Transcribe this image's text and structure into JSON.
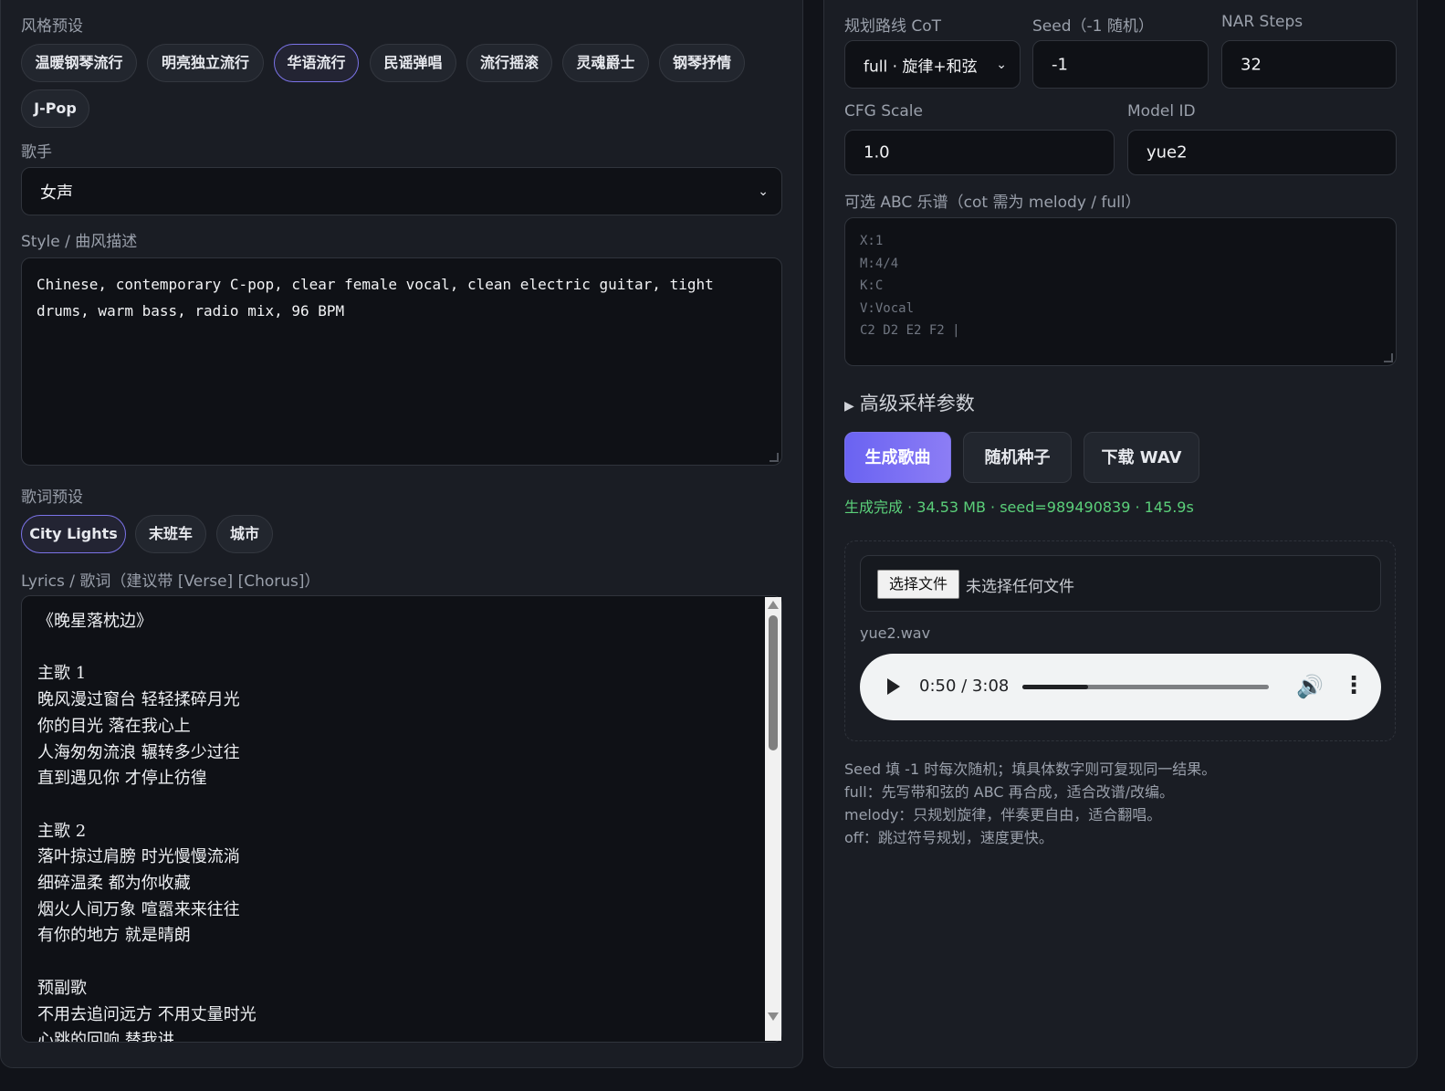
{
  "left": {
    "style_presets_label": "风格预设",
    "style_presets": [
      {
        "label": "温暖钢琴流行",
        "active": false
      },
      {
        "label": "明亮独立流行",
        "active": false
      },
      {
        "label": "华语流行",
        "active": true
      },
      {
        "label": "民谣弹唱",
        "active": false
      },
      {
        "label": "流行摇滚",
        "active": false
      },
      {
        "label": "灵魂爵士",
        "active": false
      },
      {
        "label": "钢琴抒情",
        "active": false
      },
      {
        "label": "J-Pop",
        "active": false
      }
    ],
    "singer_label": "歌手",
    "singer_value": "女声",
    "style_label": "Style / 曲风描述",
    "style_text": "Chinese, contemporary C-pop, clear female vocal, clean electric guitar, tight\ndrums, warm bass, radio mix, 96 BPM",
    "lyrics_presets_label": "歌词预设",
    "lyrics_presets": [
      {
        "label": "City Lights",
        "active": true
      },
      {
        "label": "末班车",
        "active": false
      },
      {
        "label": "城市",
        "active": false
      }
    ],
    "lyrics_label": "Lyrics / 歌词（建议带 [Verse] [Chorus]）",
    "lyrics_text": "《晚星落枕边》\n\n主歌 1\n晚风漫过窗台 轻轻揉碎月光\n你的目光 落在我心上\n人海匆匆流浪 辗转多少过往\n直到遇见你 才停止彷徨\n\n主歌 2\n落叶掠过肩膀 时光慢慢流淌\n细碎温柔 都为你收藏\n烟火人间万象 喧嚣来来往往\n有你的地方 就是晴朗\n\n预副歌\n不用去追问远方 不用丈量时光\n心跳的回响 替我讲"
  },
  "right": {
    "cot_label": "规划路线 CoT",
    "cot_value": "full · 旋律+和弦",
    "seed_label": "Seed（-1 随机）",
    "seed_value": "-1",
    "nar_label": "NAR Steps",
    "nar_value": "32",
    "cfg_label": "CFG Scale",
    "cfg_value": "1.0",
    "model_label": "Model ID",
    "model_value": "yue2",
    "abc_label": "可选 ABC 乐谱（cot 需为 melody / full）",
    "abc_placeholder": "X:1\nM:4/4\nK:C\nV:Vocal\nC2 D2 E2 F2 |",
    "advanced_label": "高级采样参数",
    "btn_generate": "生成歌曲",
    "btn_random_seed": "随机种子",
    "btn_download": "下载 WAV",
    "status_prefix": "生成完成",
    "status_detail": " · 34.53 MB · seed=989490839 · 145.9s",
    "file_button": "选择文件",
    "file_note": "未选择任何文件",
    "audio_filename": "yue2.wav",
    "audio_time": "0:50 / 3:08",
    "audio_progress": 0.2659,
    "help_lines": [
      "Seed 填 -1 时每次随机；填具体数字则可复现同一结果。",
      "full：先写带和弦的 ABC 再合成，适合改谱/改编。",
      "melody：只规划旋律，伴奏更自由，适合翻唱。",
      "off：跳过符号规划，速度更快。"
    ]
  },
  "colors": {
    "accent": "#7b73e8",
    "success": "#5bd07a",
    "background": "#111319",
    "panel": "#1a1d24"
  }
}
